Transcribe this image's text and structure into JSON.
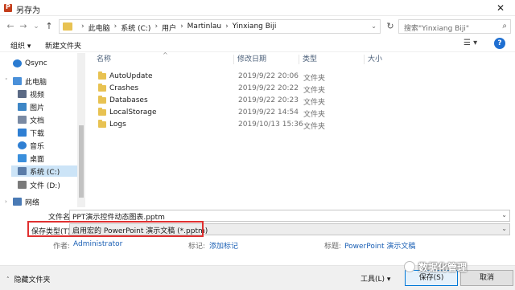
{
  "window": {
    "title": "另存为",
    "close_glyph": "✕"
  },
  "nav_buttons": {
    "back": "←",
    "forward": "→",
    "recent": "⌄",
    "up": "↑"
  },
  "address": {
    "crumbs": [
      "此电脑",
      "系统 (C:)",
      "用户",
      "Martinlau",
      "Yinxiang Biji"
    ],
    "separator": "›",
    "dropdown": "⌄",
    "refresh": "↻"
  },
  "search": {
    "placeholder": "搜索\"Yinxiang Biji\"",
    "icon": "⌕"
  },
  "toolbar": {
    "organize": "组织 ▾",
    "new_folder": "新建文件夹",
    "view": "☰ ▾",
    "help": "?"
  },
  "sidebar": {
    "items": [
      {
        "label": "Qsync",
        "icon": "qsync-icon",
        "color": "#2a7bd1"
      },
      {
        "label": "此电脑",
        "icon": "computer-icon",
        "color": "#4a90d9"
      },
      {
        "label": "视频",
        "icon": "video-icon",
        "color": "#5b6a85"
      },
      {
        "label": "图片",
        "icon": "pictures-icon",
        "color": "#3d86c6"
      },
      {
        "label": "文档",
        "icon": "documents-icon",
        "color": "#7a8aa3"
      },
      {
        "label": "下载",
        "icon": "download-icon",
        "color": "#2f7fd3"
      },
      {
        "label": "音乐",
        "icon": "music-icon",
        "color": "#2f7fd3"
      },
      {
        "label": "桌面",
        "icon": "desktop-icon",
        "color": "#3a8fdc"
      },
      {
        "label": "系统 (C:)",
        "icon": "drive-icon",
        "color": "#5a7ca8",
        "selected": true
      },
      {
        "label": "文件 (D:)",
        "icon": "drive-icon",
        "color": "#7a7a7a"
      },
      {
        "label": "网络",
        "icon": "network-icon",
        "color": "#4a7ab5"
      }
    ]
  },
  "file_list": {
    "columns": {
      "name": "名称",
      "modified": "修改日期",
      "type": "类型",
      "size": "大小"
    },
    "sort_glyph": "^",
    "rows": [
      {
        "name": "AutoUpdate",
        "modified": "2019/9/22 20:06",
        "type": "文件夹"
      },
      {
        "name": "Crashes",
        "modified": "2019/9/22 20:22",
        "type": "文件夹"
      },
      {
        "name": "Databases",
        "modified": "2019/9/22 20:23",
        "type": "文件夹"
      },
      {
        "name": "LocalStorage",
        "modified": "2019/9/22 14:54",
        "type": "文件夹"
      },
      {
        "name": "Logs",
        "modified": "2019/10/13 15:36",
        "type": "文件夹"
      }
    ]
  },
  "save_form": {
    "filename_label": "文件名(N):",
    "filename_value": "PPT演示控件动态图表.pptm",
    "filetype_label": "保存类型(T):",
    "filetype_value": "启用宏的 PowerPoint 演示文稿 (*.pptm)",
    "dropdown": "⌄",
    "author_label": "作者:",
    "author_value": "Administrator",
    "tags_label": "标记:",
    "tags_value": "添加标记",
    "title_label": "标题:",
    "title_value": "PowerPoint 演示文稿"
  },
  "footer": {
    "hide_folders": "隐藏文件夹",
    "hide_chevron": "˄",
    "tools": "工具(L) ▾",
    "save": "保存(S)",
    "cancel": "取消"
  },
  "watermark": {
    "text": "数据化管理"
  },
  "colors": {
    "folder": "#e8c252",
    "highlight": "#e03030",
    "link": "#1a5fb4"
  }
}
